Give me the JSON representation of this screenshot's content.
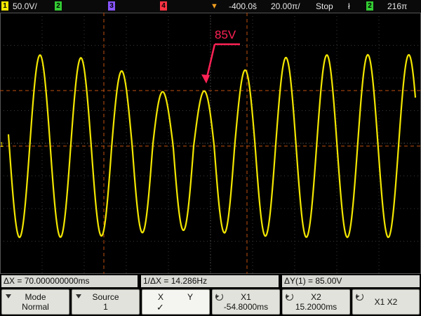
{
  "top": {
    "ch1_num": "1",
    "ch1_scale": "50.0V/",
    "ch2_num": "2",
    "ch3_num": "3",
    "ch4_num": "4",
    "delay": "-400.0š",
    "timebase": "20.00π/",
    "run_state": "Stop",
    "trig_mode_glyph": "ł",
    "trig_src_num": "2",
    "trig_level": "216π",
    "colors": {
      "ch1": "#f2e600",
      "ch2": "#33cc33",
      "ch3": "#8855ff",
      "ch4": "#ff3344"
    }
  },
  "screen": {
    "annotation": "85V",
    "annotation_color": "#ff2255",
    "trace_color": "#f2e600",
    "ch1_marker": "1",
    "waveform": {
      "type": "sine",
      "frequency_hz": 14.286,
      "peak_to_peak_v": 170
    }
  },
  "measurements": {
    "dx": "ΔX = 70.000000000ms",
    "inv_dx": "1/ΔX = 14.286Hz",
    "dy": "ΔY(1) = 85.00V"
  },
  "softkeys": {
    "mode": {
      "label": "Mode",
      "value": "Normal"
    },
    "source": {
      "label": "Source",
      "value": "1"
    },
    "x": {
      "label": "X",
      "check": "✓"
    },
    "y": {
      "label": "Y"
    },
    "x1": {
      "label": "X1",
      "value": "-54.8000ms"
    },
    "x2": {
      "label": "X2",
      "value": "15.2000ms"
    },
    "x1x2": {
      "label": "X1 X2"
    }
  }
}
